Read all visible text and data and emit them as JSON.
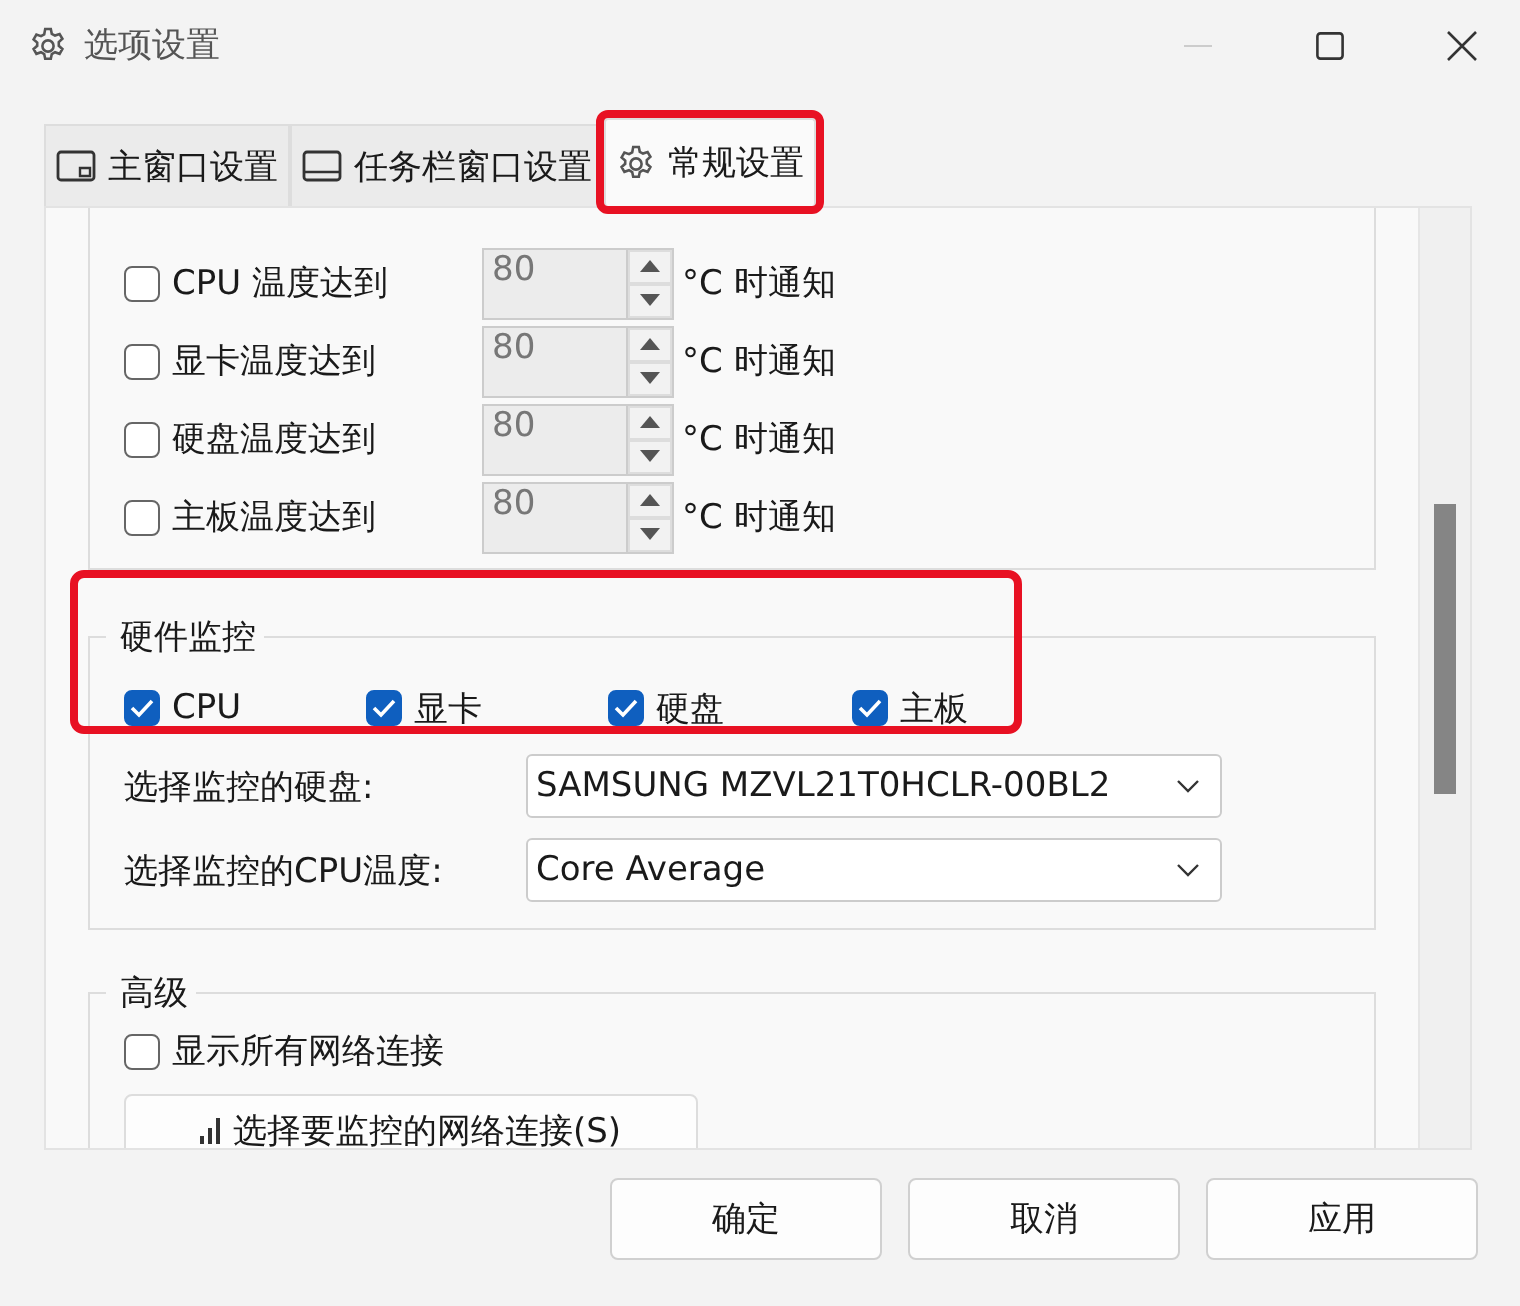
{
  "window": {
    "title": "选项设置"
  },
  "tabs": [
    {
      "label": "主窗口设置",
      "kind": "window",
      "selected": false,
      "highlighted": false
    },
    {
      "label": "任务栏窗口设置",
      "kind": "taskbar",
      "selected": false,
      "highlighted": false
    },
    {
      "label": "常规设置",
      "kind": "gear",
      "selected": true,
      "highlighted": true
    }
  ],
  "notifications": {
    "rows": [
      {
        "label": "CPU 温度达到",
        "checked": false,
        "value": "80",
        "unit": "°C 时通知"
      },
      {
        "label": "显卡温度达到",
        "checked": false,
        "value": "80",
        "unit": "°C 时通知"
      },
      {
        "label": "硬盘温度达到",
        "checked": false,
        "value": "80",
        "unit": "°C 时通知"
      },
      {
        "label": "主板温度达到",
        "checked": false,
        "value": "80",
        "unit": "°C 时通知"
      }
    ]
  },
  "hardware_monitor": {
    "title": "硬件监控",
    "highlighted": true,
    "items": [
      {
        "label": "CPU",
        "checked": true
      },
      {
        "label": "显卡",
        "checked": true
      },
      {
        "label": "硬盘",
        "checked": true
      },
      {
        "label": "主板",
        "checked": true
      }
    ],
    "selects": [
      {
        "label": "选择监控的硬盘:",
        "value": "SAMSUNG MZVL21T0HCLR-00BL2"
      },
      {
        "label": "选择监控的CPU温度:",
        "value": "Core Average"
      }
    ]
  },
  "advanced": {
    "title": "高级",
    "options": [
      {
        "label": "显示所有网络连接",
        "checked": false
      }
    ],
    "button": "选择要监控的网络连接(S)"
  },
  "buttons": [
    "确定",
    "取消",
    "应用"
  ]
}
